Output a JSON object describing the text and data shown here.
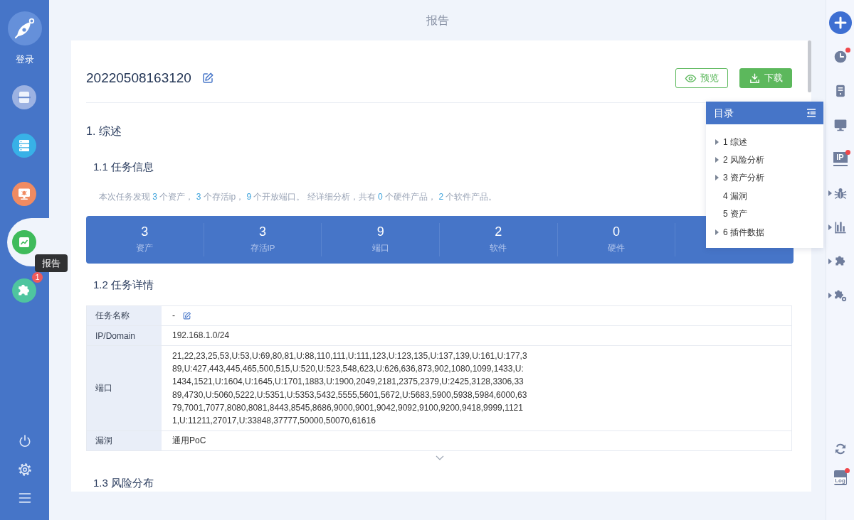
{
  "header": {
    "title": "报告"
  },
  "sidebar": {
    "login_label": "登录",
    "items": [
      {
        "color": "#9cb2e2",
        "selected": false
      },
      {
        "color": "#38b1e7",
        "selected": false
      },
      {
        "color": "#f08b62",
        "selected": false
      },
      {
        "color": "#3fbb5b",
        "selected": true,
        "tooltip": "报告"
      },
      {
        "color": "#4fc59f",
        "selected": false,
        "badge": "1"
      }
    ]
  },
  "report": {
    "title": "20220508163120",
    "buttons": [
      {
        "label": "预览",
        "kind": "outline"
      },
      {
        "label": "下载",
        "kind": "primary"
      }
    ],
    "heading": "1. 综述",
    "task_info": {
      "heading": "1.1 任务信息",
      "summary": [
        {
          "text": "本次任务发现 ",
          "highlighted": false
        },
        {
          "text": "3",
          "highlighted": true
        },
        {
          "text": " 个资产， ",
          "highlighted": false
        },
        {
          "text": "3",
          "highlighted": true
        },
        {
          "text": " 个存活ip， ",
          "highlighted": false
        },
        {
          "text": "9",
          "highlighted": true
        },
        {
          "text": " 个开放端口。 经详细分析，共有 ",
          "highlighted": false
        },
        {
          "text": "0",
          "highlighted": true
        },
        {
          "text": " 个硬件产品， ",
          "highlighted": false
        },
        {
          "text": "2",
          "highlighted": true
        },
        {
          "text": " 个软件产品。",
          "highlighted": false
        }
      ],
      "stats": [
        {
          "value": "3",
          "label": "资产"
        },
        {
          "value": "3",
          "label": "存活IP"
        },
        {
          "value": "9",
          "label": "端口"
        },
        {
          "value": "2",
          "label": "软件"
        },
        {
          "value": "0",
          "label": "硬件"
        }
      ]
    },
    "task_details": {
      "heading": "1.2 任务详情",
      "rows": [
        {
          "label": "任务名称",
          "value": "-",
          "editable": true
        },
        {
          "label": "IP/Domain",
          "value": "192.168.1.0/24",
          "editable": false
        },
        {
          "label": "端口",
          "value": "21,22,23,25,53,U:53,U:69,80,81,U:88,110,111,U:111,123,U:123,135,U:137,139,U:161,U:177,389,U:427,443,445,465,500,515,U:520,U:523,548,623,U:626,636,873,902,1080,1099,1433,U:1434,1521,U:1604,U:1645,U:1701,1883,U:1900,2049,2181,2375,2379,U:2425,3128,3306,3389,4730,U:5060,5222,U:5351,U:5353,5432,5555,5601,5672,U:5683,5900,5938,5984,6000,6379,7001,7077,8080,8081,8443,8545,8686,9000,9001,9042,9092,9100,9200,9418,9999,11211,U:11211,27017,U:33848,37777,50000,50070,61616",
          "editable": false
        },
        {
          "label": "漏洞",
          "value": "通用PoC",
          "editable": false
        }
      ]
    },
    "risk": {
      "heading": "1.3 风险分布"
    }
  },
  "toc": {
    "title": "目录",
    "items": [
      {
        "label": "1 综述",
        "expandable": true
      },
      {
        "label": "2 风险分析",
        "expandable": true
      },
      {
        "label": "3 资产分析",
        "expandable": true
      },
      {
        "label": "4 漏洞",
        "expandable": false
      },
      {
        "label": "5 资产",
        "expandable": false
      },
      {
        "label": "6 插件数据",
        "expandable": true
      }
    ]
  },
  "right_toolbar": {
    "top": [
      {
        "alert": false,
        "expandable": false
      },
      {
        "alert": true,
        "expandable": false
      },
      {
        "alert": false,
        "expandable": false
      },
      {
        "alert": false,
        "expandable": false
      },
      {
        "label": "IP",
        "alert": true,
        "expandable": false
      },
      {
        "alert": false,
        "expandable": true
      },
      {
        "alert": false,
        "expandable": true
      },
      {
        "alert": false,
        "expandable": true
      },
      {
        "alert": false,
        "expandable": true
      }
    ],
    "bottom": [
      {
        "alert": false,
        "expandable": false
      },
      {
        "label": "Log",
        "alert": true,
        "expandable": false
      }
    ]
  }
}
